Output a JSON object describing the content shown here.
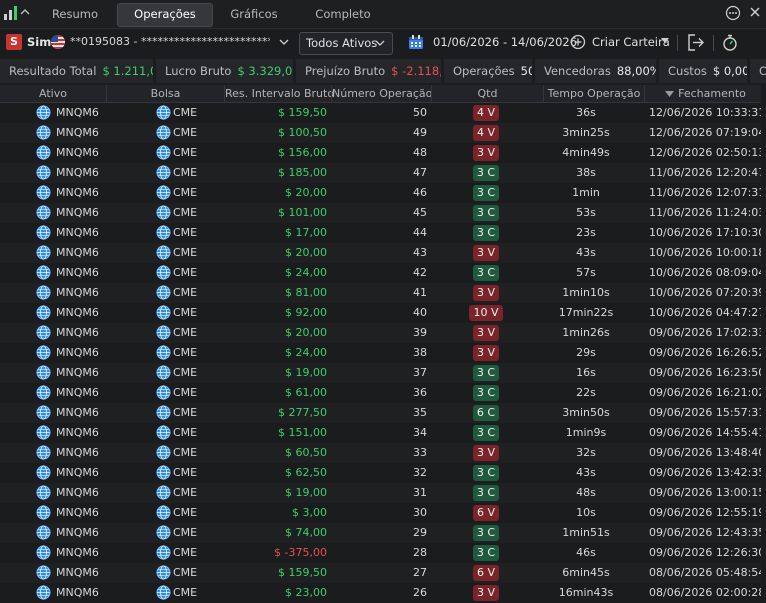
{
  "tabs": [
    "Resumo",
    "Operações",
    "Gráficos",
    "Completo"
  ],
  "active_tab": "Operações",
  "toolbar": {
    "sim_badge": "S",
    "sim_label": "Sim",
    "account": "**0195083 - ************************...",
    "asset_filter": "Todos Ativos",
    "date_range": "01/06/2026 - 14/06/2026",
    "wallet_label": "Criar Carteira"
  },
  "summary": {
    "resultado_total": {
      "label": "Resultado Total",
      "value": "$ 1.211,00"
    },
    "lucro_bruto": {
      "label": "Lucro Bruto",
      "value": "$ 3.329,00"
    },
    "prejuizo_bruto": {
      "label": "Prejuízo Bruto",
      "value": "$ -2.118,00"
    },
    "operacoes": {
      "label": "Operações",
      "value": "50"
    },
    "vencedoras": {
      "label": "Vencedoras",
      "value": "88,00%"
    },
    "custos": {
      "label": "Custos",
      "value": "$ 0,00"
    },
    "extra": {
      "label": "C",
      "value": ""
    }
  },
  "colors": {
    "positive": "#3ecf6a",
    "negative": "#e5524f",
    "sell_badge": "#7a2328",
    "buy_badge": "#1f5a3e",
    "sim_badge": "#c8342f"
  },
  "table": {
    "headers": [
      "Ativo",
      "Bolsa",
      "Res. Intervalo Bruto",
      "Número Operação",
      "Qtd",
      "Tempo Operação",
      "Fechamento"
    ],
    "sorted_column": "Fechamento",
    "rows": [
      {
        "ativo": "MNQM6",
        "bolsa": "CME",
        "res": "$ 159,50",
        "sign": "pos",
        "num": "50",
        "qtd": "4 V",
        "side": "v",
        "tempo": "36s",
        "fechamento": "12/06/2026 10:33:31"
      },
      {
        "ativo": "MNQM6",
        "bolsa": "CME",
        "res": "$ 100,50",
        "sign": "pos",
        "num": "49",
        "qtd": "4 V",
        "side": "v",
        "tempo": "3min25s",
        "fechamento": "12/06/2026 07:19:04"
      },
      {
        "ativo": "MNQM6",
        "bolsa": "CME",
        "res": "$ 156,00",
        "sign": "pos",
        "num": "48",
        "qtd": "3 V",
        "side": "v",
        "tempo": "4min49s",
        "fechamento": "12/06/2026 02:50:13"
      },
      {
        "ativo": "MNQM6",
        "bolsa": "CME",
        "res": "$ 185,00",
        "sign": "pos",
        "num": "47",
        "qtd": "3 C",
        "side": "c",
        "tempo": "38s",
        "fechamento": "11/06/2026 12:20:47"
      },
      {
        "ativo": "MNQM6",
        "bolsa": "CME",
        "res": "$ 20,00",
        "sign": "pos",
        "num": "46",
        "qtd": "3 C",
        "side": "c",
        "tempo": "1min",
        "fechamento": "11/06/2026 12:07:31"
      },
      {
        "ativo": "MNQM6",
        "bolsa": "CME",
        "res": "$ 101,00",
        "sign": "pos",
        "num": "45",
        "qtd": "3 C",
        "side": "c",
        "tempo": "53s",
        "fechamento": "11/06/2026 11:24:03"
      },
      {
        "ativo": "MNQM6",
        "bolsa": "CME",
        "res": "$ 17,00",
        "sign": "pos",
        "num": "44",
        "qtd": "3 C",
        "side": "c",
        "tempo": "23s",
        "fechamento": "10/06/2026 17:10:30"
      },
      {
        "ativo": "MNQM6",
        "bolsa": "CME",
        "res": "$ 20,00",
        "sign": "pos",
        "num": "43",
        "qtd": "3 V",
        "side": "v",
        "tempo": "43s",
        "fechamento": "10/06/2026 10:00:18"
      },
      {
        "ativo": "MNQM6",
        "bolsa": "CME",
        "res": "$ 24,00",
        "sign": "pos",
        "num": "42",
        "qtd": "3 C",
        "side": "c",
        "tempo": "57s",
        "fechamento": "10/06/2026 08:09:04"
      },
      {
        "ativo": "MNQM6",
        "bolsa": "CME",
        "res": "$ 81,00",
        "sign": "pos",
        "num": "41",
        "qtd": "3 V",
        "side": "v",
        "tempo": "1min10s",
        "fechamento": "10/06/2026 07:20:39"
      },
      {
        "ativo": "MNQM6",
        "bolsa": "CME",
        "res": "$ 92,00",
        "sign": "pos",
        "num": "40",
        "qtd": "10 V",
        "side": "v",
        "tempo": "17min22s",
        "fechamento": "10/06/2026 04:47:27"
      },
      {
        "ativo": "MNQM6",
        "bolsa": "CME",
        "res": "$ 20,00",
        "sign": "pos",
        "num": "39",
        "qtd": "3 V",
        "side": "v",
        "tempo": "1min26s",
        "fechamento": "09/06/2026 17:02:33"
      },
      {
        "ativo": "MNQM6",
        "bolsa": "CME",
        "res": "$ 24,00",
        "sign": "pos",
        "num": "38",
        "qtd": "3 V",
        "side": "v",
        "tempo": "29s",
        "fechamento": "09/06/2026 16:26:52"
      },
      {
        "ativo": "MNQM6",
        "bolsa": "CME",
        "res": "$ 19,00",
        "sign": "pos",
        "num": "37",
        "qtd": "3 C",
        "side": "c",
        "tempo": "16s",
        "fechamento": "09/06/2026 16:23:50"
      },
      {
        "ativo": "MNQM6",
        "bolsa": "CME",
        "res": "$ 61,00",
        "sign": "pos",
        "num": "36",
        "qtd": "3 C",
        "side": "c",
        "tempo": "22s",
        "fechamento": "09/06/2026 16:21:02"
      },
      {
        "ativo": "MNQM6",
        "bolsa": "CME",
        "res": "$ 277,50",
        "sign": "pos",
        "num": "35",
        "qtd": "6 C",
        "side": "c",
        "tempo": "3min50s",
        "fechamento": "09/06/2026 15:57:31"
      },
      {
        "ativo": "MNQM6",
        "bolsa": "CME",
        "res": "$ 151,00",
        "sign": "pos",
        "num": "34",
        "qtd": "3 C",
        "side": "c",
        "tempo": "1min9s",
        "fechamento": "09/06/2026 14:55:41"
      },
      {
        "ativo": "MNQM6",
        "bolsa": "CME",
        "res": "$ 60,50",
        "sign": "pos",
        "num": "33",
        "qtd": "3 V",
        "side": "v",
        "tempo": "32s",
        "fechamento": "09/06/2026 13:48:40"
      },
      {
        "ativo": "MNQM6",
        "bolsa": "CME",
        "res": "$ 62,50",
        "sign": "pos",
        "num": "32",
        "qtd": "3 C",
        "side": "c",
        "tempo": "43s",
        "fechamento": "09/06/2026 13:42:35"
      },
      {
        "ativo": "MNQM6",
        "bolsa": "CME",
        "res": "$ 19,00",
        "sign": "pos",
        "num": "31",
        "qtd": "3 C",
        "side": "c",
        "tempo": "48s",
        "fechamento": "09/06/2026 13:00:15"
      },
      {
        "ativo": "MNQM6",
        "bolsa": "CME",
        "res": "$ 3,00",
        "sign": "pos",
        "num": "30",
        "qtd": "6 V",
        "side": "v",
        "tempo": "10s",
        "fechamento": "09/06/2026 12:55:19"
      },
      {
        "ativo": "MNQM6",
        "bolsa": "CME",
        "res": "$ 74,00",
        "sign": "pos",
        "num": "29",
        "qtd": "3 C",
        "side": "c",
        "tempo": "1min51s",
        "fechamento": "09/06/2026 12:43:35"
      },
      {
        "ativo": "MNQM6",
        "bolsa": "CME",
        "res": "$ -375,00",
        "sign": "neg",
        "num": "28",
        "qtd": "3 C",
        "side": "c",
        "tempo": "46s",
        "fechamento": "09/06/2026 12:26:30"
      },
      {
        "ativo": "MNQM6",
        "bolsa": "CME",
        "res": "$ 159,50",
        "sign": "pos",
        "num": "27",
        "qtd": "6 V",
        "side": "v",
        "tempo": "6min45s",
        "fechamento": "08/06/2026 05:48:54"
      },
      {
        "ativo": "MNQM6",
        "bolsa": "CME",
        "res": "$ 23,00",
        "sign": "pos",
        "num": "26",
        "qtd": "3 V",
        "side": "v",
        "tempo": "16min43s",
        "fechamento": "08/06/2026 02:00:28"
      }
    ]
  }
}
